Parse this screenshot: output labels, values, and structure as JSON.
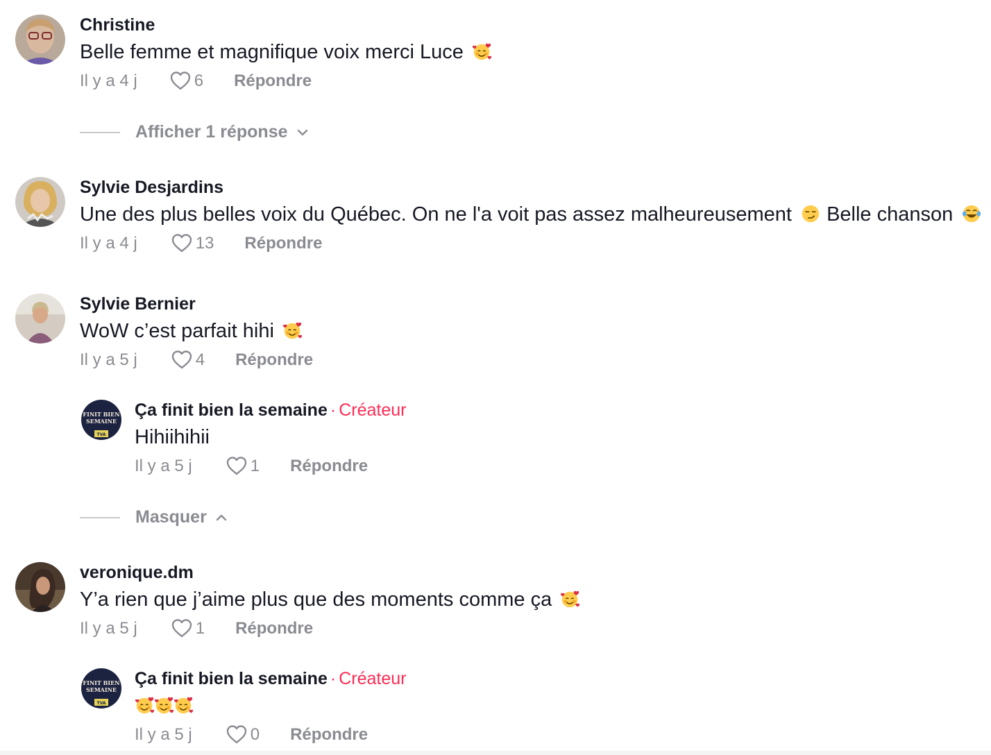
{
  "comments": [
    {
      "username": "Christine",
      "text": "Belle femme et magnifique voix merci Luce",
      "time": "Il y a 4 j",
      "likes": "6",
      "reply_label": "Répondre",
      "emojis": [
        "smiling-face-with-hearts"
      ]
    },
    {
      "username": "Sylvie Desjardins",
      "text": "Une des plus belles voix du Québec. On ne l'a voit pas assez malheureusement",
      "text2": "Belle chanson",
      "time": "Il y a 4 j",
      "likes": "13",
      "reply_label": "Répondre",
      "emojis": [
        "smirking-face",
        "face-with-tears-of-joy"
      ]
    },
    {
      "username": "Sylvie Bernier",
      "text": "WoW c’est parfait hihi",
      "time": "Il y a 5 j",
      "likes": "4",
      "reply_label": "Répondre",
      "emojis": [
        "smiling-face-with-hearts"
      ]
    },
    {
      "username": "veronique.dm",
      "text": "Y’a rien que j’aime plus que des moments comme ça",
      "time": "Il y a 5 j",
      "likes": "1",
      "reply_label": "Répondre",
      "emojis": [
        "smiling-face-with-hearts"
      ]
    }
  ],
  "replies": [
    {
      "username": "Ça finit bien la semaine",
      "creator_label": "Créateur",
      "separator": "·",
      "text": "Hihiihihii",
      "time": "Il y a 5 j",
      "likes": "1",
      "reply_label": "Répondre",
      "avatar_text": [
        "FINIT BIEN",
        "SEMAINE",
        "TVA"
      ]
    },
    {
      "username": "Ça finit bien la semaine",
      "creator_label": "Créateur",
      "separator": "·",
      "text": "",
      "time": "Il y a 5 j",
      "likes": "0",
      "reply_label": "Répondre",
      "emojis": [
        "smiling-face-with-hearts",
        "smiling-face-with-hearts",
        "smiling-face-with-hearts"
      ],
      "avatar_text": [
        "FINIT BIEN",
        "SEMAINE",
        "TVA"
      ]
    }
  ],
  "toggles": {
    "show_replies": "Afficher 1 réponse",
    "hide": "Masquer"
  },
  "colors": {
    "creator": "#fe2c55",
    "meta": "#8a8b91",
    "text": "#161823"
  }
}
